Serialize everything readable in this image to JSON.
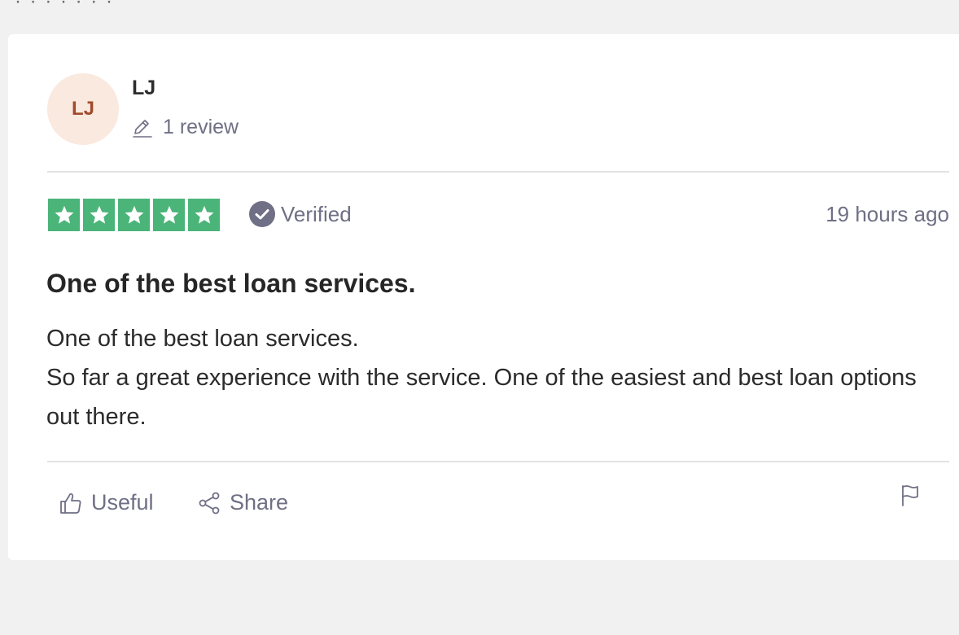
{
  "reviewer": {
    "initials": "LJ",
    "name": "LJ",
    "review_count": "1 review"
  },
  "rating": {
    "stars": 5,
    "max": 5,
    "star_color": "#4bb479"
  },
  "verified_label": "Verified",
  "timestamp": "19 hours ago",
  "review": {
    "title": "One of the best loan services.",
    "lines": [
      "One of the best loan services.",
      "So far a great experience with the service. One of the easiest and best loan options out there."
    ]
  },
  "actions": {
    "useful_label": "Useful",
    "share_label": "Share"
  },
  "icons": [
    "pencil-icon",
    "star-icon",
    "verified-check-icon",
    "thumbs-up-icon",
    "share-icon",
    "flag-icon"
  ],
  "colors": {
    "avatar_bg": "#f9e9df",
    "avatar_text": "#a14b2c",
    "muted_text": "#6f6f85"
  }
}
